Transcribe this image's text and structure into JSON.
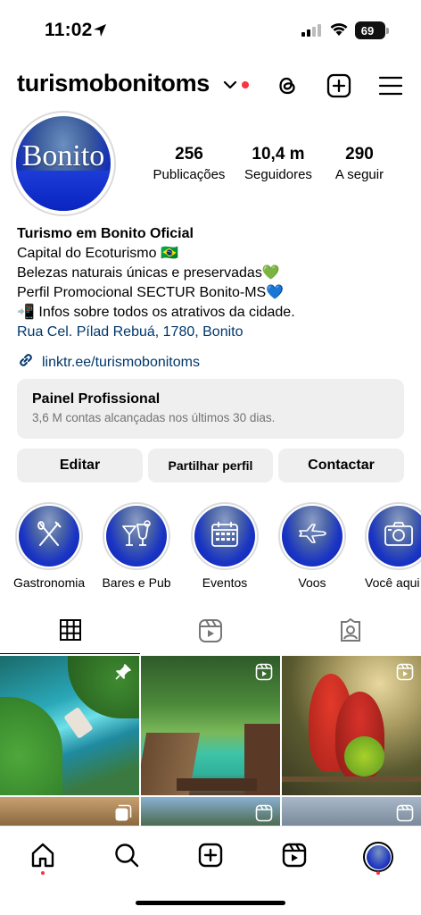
{
  "status_bar": {
    "time": "11:02",
    "battery": "69",
    "battery_level": 0.69
  },
  "header": {
    "username": "turismobonitoms",
    "icons": [
      "chevron-down-icon",
      "threads-icon",
      "add-icon",
      "menu-icon"
    ]
  },
  "profile": {
    "avatar_text": "Bonito",
    "stats": [
      {
        "value": "256",
        "label": "Publicações"
      },
      {
        "value": "10,4 m",
        "label": "Seguidores"
      },
      {
        "value": "290",
        "label": "A seguir"
      }
    ],
    "bio": {
      "name": "Turismo em Bonito Oficial",
      "lines": [
        "Capital do Ecoturismo 🇧🇷",
        "Belezas naturais únicas e preservadas💚",
        "Perfil Promocional SECTUR Bonito-MS💙",
        "📲 Infos sobre todos os atrativos da cidade."
      ],
      "address": "Rua Cel. Pílad Rebuá, 1780, Bonito"
    },
    "link": "linktr.ee/turismobonitoms"
  },
  "dashboard": {
    "title": "Painel Profissional",
    "subtitle": "3,6 M contas alcançadas nos últimos 30 dias."
  },
  "buttons": {
    "edit": "Editar",
    "share": "Partilhar perfil",
    "contact": "Contactar"
  },
  "highlights": [
    {
      "label": "Gastronomia",
      "icon": "cutlery-icon"
    },
    {
      "label": "Bares e Pub",
      "icon": "cocktail-icon"
    },
    {
      "label": "Eventos",
      "icon": "calendar-icon"
    },
    {
      "label": "Voos",
      "icon": "airplane-icon"
    },
    {
      "label": "Você aqui",
      "icon": "camera-icon"
    }
  ],
  "tabs": [
    "grid-icon",
    "reels-icon",
    "tagged-icon"
  ],
  "nav": [
    "home-icon",
    "search-icon",
    "create-icon",
    "reels-icon",
    "profile-avatar"
  ],
  "colors": {
    "accent_link": "#00376b",
    "notification": "#ff3040",
    "button_bg": "#efefef"
  }
}
